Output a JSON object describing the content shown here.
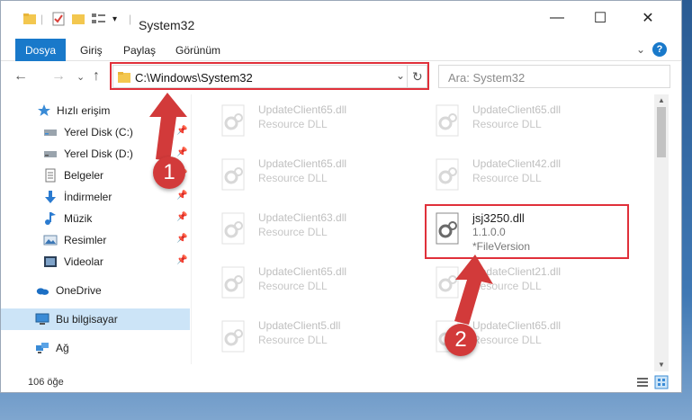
{
  "window": {
    "title": "System32",
    "minimize_label": "—",
    "maximize_label": "☐",
    "close_label": "✕"
  },
  "ribbon": {
    "tabs": [
      "Dosya",
      "Giriş",
      "Paylaş",
      "Görünüm"
    ],
    "help_label": "?",
    "expand_label": "⌄"
  },
  "nav": {
    "back": "←",
    "forward": "→",
    "recent": "⌄",
    "up": "↑",
    "address": "C:\\Windows\\System32",
    "address_dropdown": "⌄",
    "refresh": "↻",
    "search_placeholder": "Ara: System32"
  },
  "sidebar": {
    "items": [
      {
        "label": "Hızlı erişim",
        "icon": "star-icon",
        "pinned": false
      },
      {
        "label": "Yerel Disk (C:)",
        "icon": "drive-icon",
        "pinned": true
      },
      {
        "label": "Yerel Disk (D:)",
        "icon": "drive-icon",
        "pinned": true
      },
      {
        "label": "Belgeler",
        "icon": "documents-icon",
        "pinned": true
      },
      {
        "label": "İndirmeler",
        "icon": "download-icon",
        "pinned": true
      },
      {
        "label": "Müzik",
        "icon": "music-icon",
        "pinned": true
      },
      {
        "label": "Resimler",
        "icon": "pictures-icon",
        "pinned": true
      },
      {
        "label": "Videolar",
        "icon": "video-icon",
        "pinned": true
      },
      {
        "label": "OneDrive",
        "icon": "cloud-icon",
        "pinned": false
      },
      {
        "label": "Bu bilgisayar",
        "icon": "computer-icon",
        "pinned": false,
        "selected": true
      },
      {
        "label": "Ağ",
        "icon": "network-icon",
        "pinned": false
      }
    ],
    "pin_glyph": "📌"
  },
  "files": {
    "left": [
      {
        "name": "UpdateClient65.dll",
        "type": "Resource DLL"
      },
      {
        "name": "UpdateClient65.dll",
        "type": "Resource DLL"
      },
      {
        "name": "UpdateClient63.dll",
        "type": "Resource DLL"
      },
      {
        "name": "UpdateClient65.dll",
        "type": "Resource DLL"
      },
      {
        "name": "UpdateClient5.dll",
        "type": "Resource DLL"
      }
    ],
    "right": [
      {
        "name": "UpdateClient65.dll",
        "type": "Resource DLL"
      },
      {
        "name": "UpdateClient42.dll",
        "type": "Resource DLL"
      },
      {
        "name": "jsj3250.dll",
        "type": "1.1.0.0",
        "version": "*FileVersion",
        "highlighted": true
      },
      {
        "name": "UpdateClient21.dll",
        "type": "Resource DLL"
      },
      {
        "name": "UpdateClient65.dll",
        "type": "Resource DLL"
      }
    ]
  },
  "status": {
    "item_count": "106 öğe"
  },
  "annotations": {
    "marker_1": "1",
    "marker_2": "2",
    "color": "#d23a3a"
  },
  "colors": {
    "accent": "#1979ca",
    "selected_bg": "#cce4f7"
  }
}
